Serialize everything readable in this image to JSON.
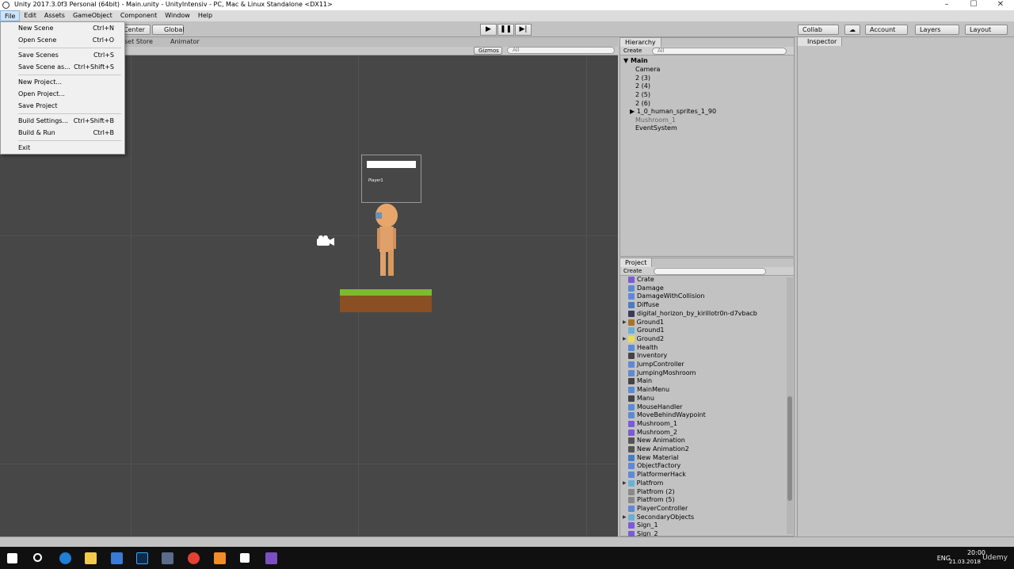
{
  "window": {
    "title": "Unity 2017.3.0f3 Personal (64bit) - Main.unity - UnityIntensiv - PC, Mac & Linux Standalone <DX11>",
    "minimize": "–",
    "maximize": "☐",
    "close": "✕"
  },
  "menubar": [
    "File",
    "Edit",
    "Assets",
    "GameObject",
    "Component",
    "Window",
    "Help"
  ],
  "toolbar": {
    "center": "Center",
    "global": "Global",
    "collab": "Collab",
    "account": "Account",
    "layers": "Layers",
    "layout": "Layout"
  },
  "scene_tabs": {
    "asset_store": "set Store",
    "animator": "Animator"
  },
  "scene_bar": {
    "gizmos": "Gizmos",
    "search": "All"
  },
  "scene": {
    "player_label": "Player1"
  },
  "hierarchy": {
    "tab": "Hierarchy",
    "create": "Create",
    "search": "All",
    "scene": "Main",
    "items": [
      "Camera",
      "2 (3)",
      "2 (4)",
      "2 (5)",
      "2 (6)",
      "1_0_human_sprites_1_90",
      "Mushroom_1",
      "EventSystem"
    ]
  },
  "inspector": {
    "tab": "Inspector"
  },
  "project": {
    "tab": "Project",
    "create": "Create",
    "items": [
      {
        "name": "Crate",
        "color": "#7b5bd6"
      },
      {
        "name": "Damage",
        "color": "#5d8ad6"
      },
      {
        "name": "DamageWithCollision",
        "color": "#5d8ad6"
      },
      {
        "name": "Diffuse",
        "color": "#4a7bc8"
      },
      {
        "name": "digital_horizon_by_kirillotr0n-d7vbacb",
        "color": "#3a3a5a"
      },
      {
        "name": "Ground1",
        "color": "#a5762a"
      },
      {
        "name": "Ground1",
        "color": "#6ab0d6"
      },
      {
        "name": "Ground2",
        "color": "#e8dc5a"
      },
      {
        "name": "Health",
        "color": "#5d8ad6"
      },
      {
        "name": "Inventory",
        "color": "#444444"
      },
      {
        "name": "JumpController",
        "color": "#5d8ad6"
      },
      {
        "name": "JumpingMoshroom",
        "color": "#5d8ad6"
      },
      {
        "name": "Main",
        "color": "#444444"
      },
      {
        "name": "MainMenu",
        "color": "#5d8ad6"
      },
      {
        "name": "Manu",
        "color": "#444444"
      },
      {
        "name": "MouseHandler",
        "color": "#5d8ad6"
      },
      {
        "name": "MoveBehindWaypoint",
        "color": "#5d8ad6"
      },
      {
        "name": "Mushroom_1",
        "color": "#7b5bd6"
      },
      {
        "name": "Mushroom_2",
        "color": "#7b5bd6"
      },
      {
        "name": "New Animation",
        "color": "#555555"
      },
      {
        "name": "New Animation2",
        "color": "#555555"
      },
      {
        "name": "New Material",
        "color": "#4a7bc8"
      },
      {
        "name": "ObjectFactory",
        "color": "#5d8ad6"
      },
      {
        "name": "PlatformerHack",
        "color": "#5d8ad6"
      },
      {
        "name": "Platfrom",
        "color": "#6ab0d6"
      },
      {
        "name": "Platfrom (2)",
        "color": "#888888"
      },
      {
        "name": "Platfrom (5)",
        "color": "#888888"
      },
      {
        "name": "PlayerController",
        "color": "#5d8ad6"
      },
      {
        "name": "SecondaryObjects",
        "color": "#6ab0d6"
      },
      {
        "name": "Sign_1",
        "color": "#7b5bd6"
      },
      {
        "name": "Sign_2",
        "color": "#7b5bd6"
      }
    ]
  },
  "file_menu": [
    {
      "label": "New Scene",
      "shortcut": "Ctrl+N"
    },
    {
      "label": "Open Scene",
      "shortcut": "Ctrl+O"
    },
    {
      "label": "Save Scenes",
      "shortcut": "Ctrl+S"
    },
    {
      "label": "Save Scene as...",
      "shortcut": "Ctrl+Shift+S"
    },
    {
      "label": "New Project...",
      "shortcut": ""
    },
    {
      "label": "Open Project...",
      "shortcut": ""
    },
    {
      "label": "Save Project",
      "shortcut": ""
    },
    {
      "label": "Build Settings...",
      "shortcut": "Ctrl+Shift+B"
    },
    {
      "label": "Build & Run",
      "shortcut": "Ctrl+B"
    },
    {
      "label": "Exit",
      "shortcut": ""
    }
  ],
  "taskbar": {
    "lang": "ENG",
    "time": "20:00",
    "date": "21.03.2018",
    "watermark": "Udemy"
  }
}
